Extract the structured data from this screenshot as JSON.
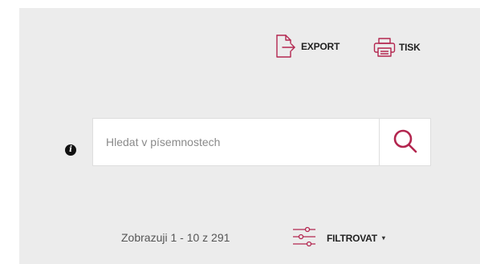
{
  "colors": {
    "accent": "#b3264f",
    "panel_bg": "#ececec"
  },
  "toolbar": {
    "export": {
      "label": "EXPORT",
      "icon": "file-export-icon"
    },
    "print": {
      "label": "TISK",
      "icon": "printer-icon"
    }
  },
  "search": {
    "placeholder": "Hledat v písemnostech",
    "value": "",
    "info_icon": "info-icon",
    "button_icon": "search-icon"
  },
  "results": {
    "summary": "Zobrazuji 1 - 10 z 291"
  },
  "filter": {
    "label": "FILTROVAT",
    "caret": "▾",
    "icon": "sliders-icon"
  }
}
